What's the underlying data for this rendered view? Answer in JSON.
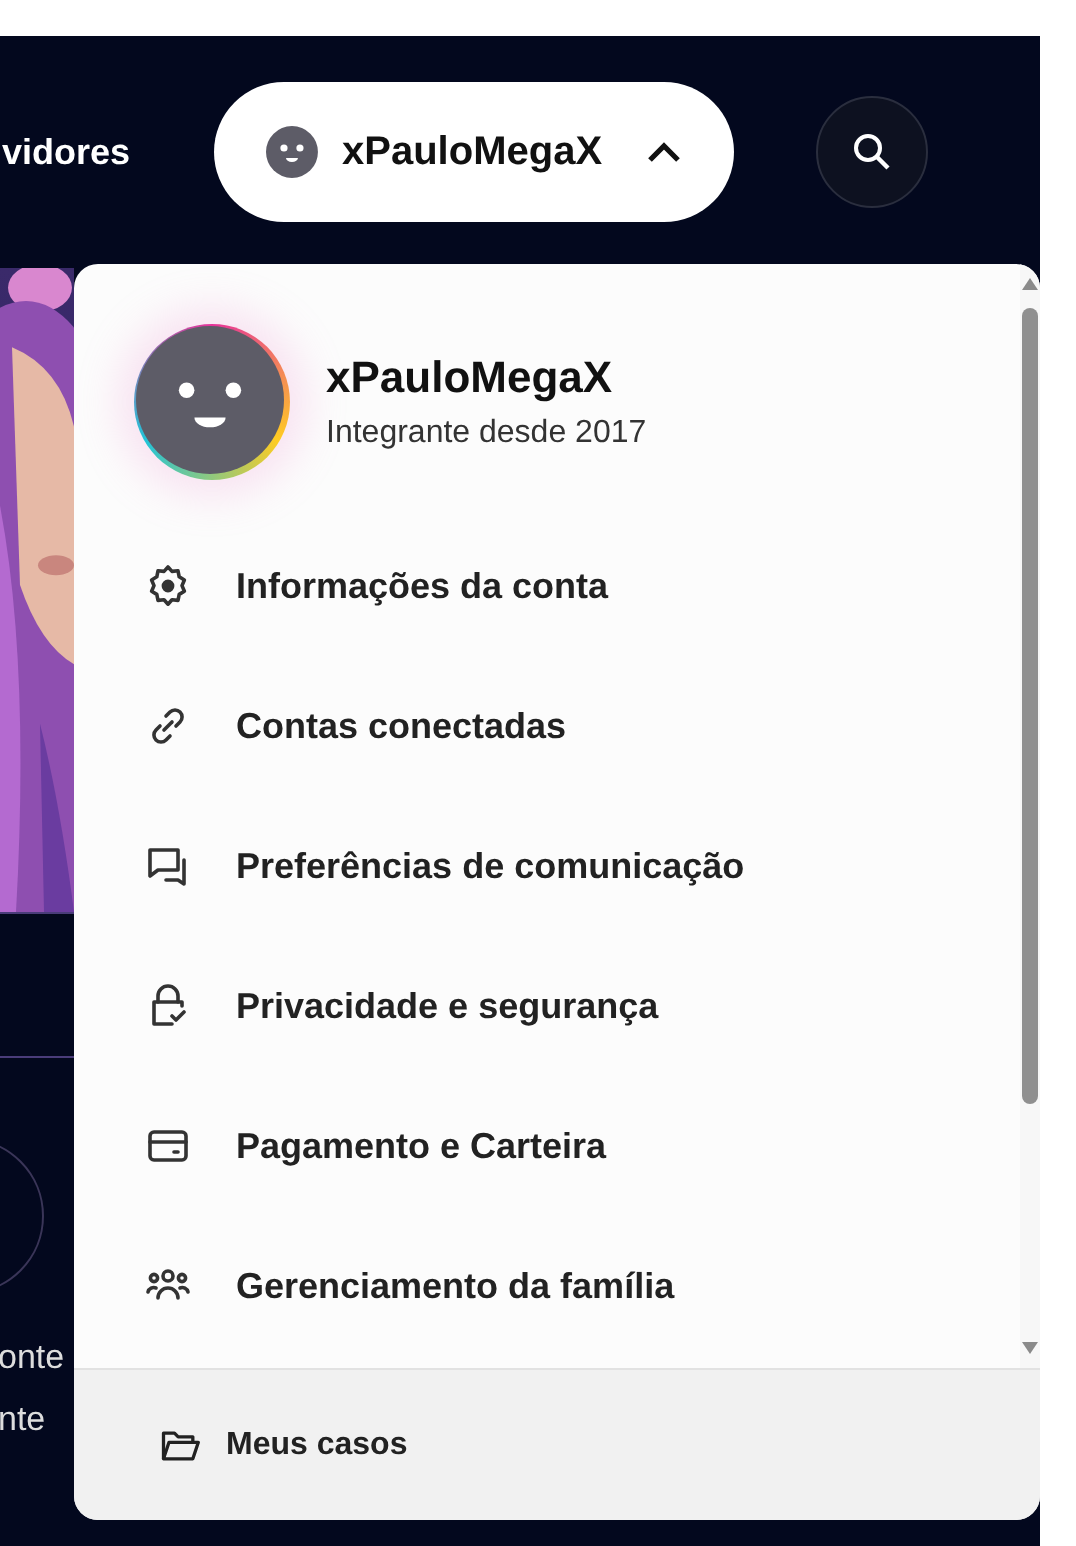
{
  "header": {
    "nav_link": "vidores",
    "account_button": {
      "username": "xPauloMegaX",
      "expanded": true
    }
  },
  "side_texts": [
    "onte",
    "nte"
  ],
  "menu": {
    "profile": {
      "username": "xPauloMegaX",
      "member_since": "Integrante desde 2017"
    },
    "items": [
      {
        "label": "Informações da conta",
        "kind": "gear"
      },
      {
        "label": "Contas conectadas",
        "kind": "link"
      },
      {
        "label": "Preferências de comunicação",
        "kind": "chat"
      },
      {
        "label": "Privacidade e segurança",
        "kind": "lock"
      },
      {
        "label": "Pagamento e Carteira",
        "kind": "card"
      },
      {
        "label": "Gerenciamento da família",
        "kind": "people"
      }
    ],
    "footer": {
      "label": "Meus casos"
    }
  }
}
